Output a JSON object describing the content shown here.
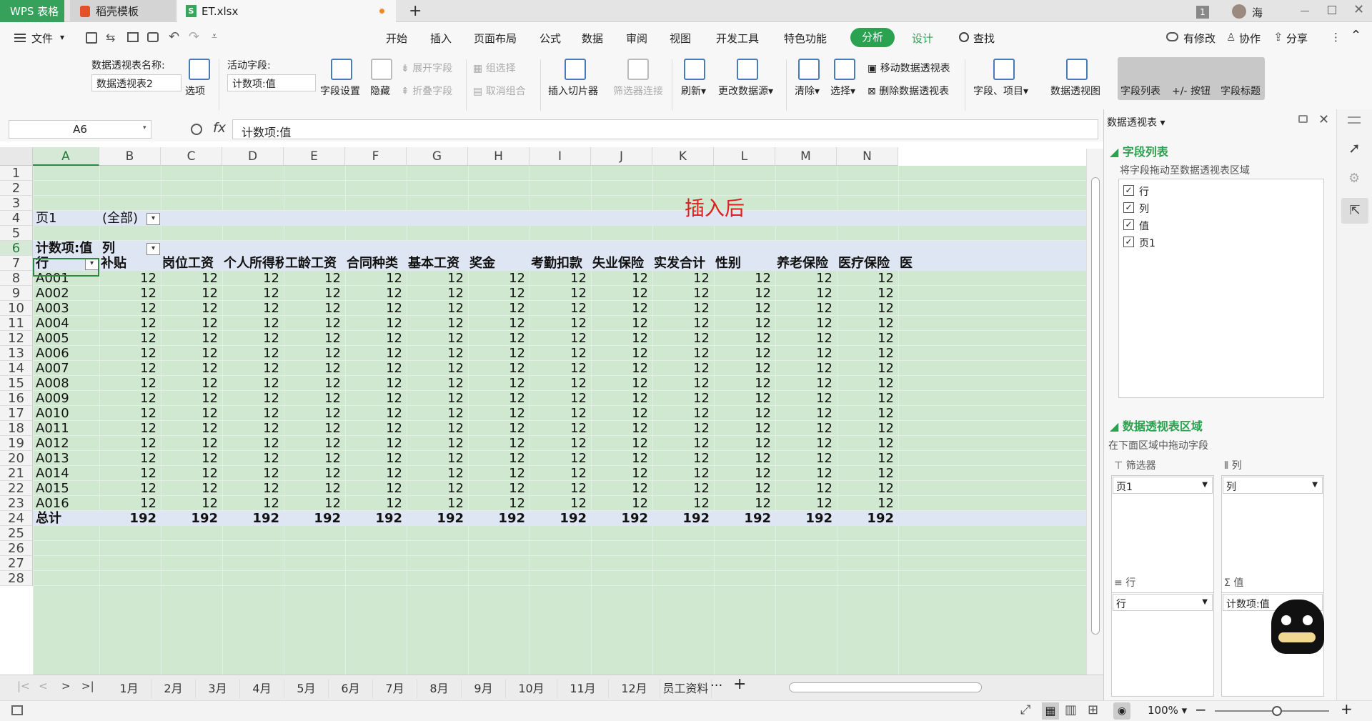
{
  "tabs": {
    "app": "WPS 表格",
    "t1": "稻壳模板",
    "t2": "ET.xlsx",
    "badge": "1",
    "user": "海"
  },
  "menu": {
    "file": "文件",
    "items": [
      "开始",
      "插入",
      "页面布局",
      "公式",
      "数据",
      "审阅",
      "视图",
      "开发工具",
      "特色功能",
      "分析",
      "设计"
    ],
    "search": "查找",
    "right": [
      "有修改",
      "协作",
      "分享"
    ]
  },
  "ribbon": {
    "pt_name_label": "数据透视表名称:",
    "pt_name": "数据透视表2",
    "options": "选项",
    "active_label": "活动字段:",
    "active_value": "计数项:值",
    "field_settings": "字段设置",
    "hide": "隐藏",
    "expand": "展开字段",
    "collapse": "折叠字段",
    "group": "组选择",
    "ungroup": "取消组合",
    "slicer": "插入切片器",
    "filter_conn": "筛选器连接",
    "refresh": "刷新",
    "change_source": "更改数据源",
    "clear": "清除",
    "select": "选择",
    "move_pt": "移动数据透视表",
    "delete_pt": "删除数据透视表",
    "fields_items": "字段、项目",
    "pt_chart": "数据透视图",
    "field_list": "字段列表",
    "buttons": "+/- 按钮",
    "headers": "字段标题"
  },
  "formula": {
    "namebox": "A6",
    "fx": "fx",
    "content": "计数项:值"
  },
  "sheet": {
    "columns": [
      "A",
      "B",
      "C",
      "D",
      "E",
      "F",
      "G",
      "H",
      "I",
      "J",
      "K",
      "L",
      "M",
      "N"
    ],
    "rows": [
      "1",
      "2",
      "3",
      "4",
      "5",
      "6",
      "7",
      "8",
      "9",
      "10",
      "11",
      "12",
      "13",
      "14",
      "15",
      "16",
      "17",
      "18",
      "19",
      "20",
      "21",
      "22",
      "23",
      "24",
      "25",
      "26",
      "27",
      "28"
    ],
    "annotation": "插入后",
    "page_label": "页1",
    "page_value": "(全部)",
    "value_label": "计数项:值",
    "col_label": "列",
    "row_label": "行",
    "col_headers": [
      "补贴",
      "岗位工资",
      "个人所得税",
      "工龄工资",
      "合同种类",
      "基本工资",
      "奖金",
      "考勤扣款",
      "失业保险",
      "实发合计",
      "性别",
      "养老保险",
      "医疗保险",
      "医"
    ],
    "row_items": [
      "A001",
      "A002",
      "A003",
      "A004",
      "A005",
      "A006",
      "A007",
      "A008",
      "A009",
      "A010",
      "A011",
      "A012",
      "A013",
      "A014",
      "A015",
      "A016"
    ],
    "cell_value": "12",
    "total_label": "总计",
    "total_value": "192"
  },
  "sheet_tabs": [
    "1月",
    "2月",
    "3月",
    "4月",
    "5月",
    "6月",
    "7月",
    "8月",
    "9月",
    "10月",
    "11月",
    "12月",
    "员工资料"
  ],
  "status": {
    "zoom": "100%"
  },
  "panel": {
    "title": "数据透视表",
    "field_list": "字段列表",
    "drag_hint": "将字段拖动至数据透视表区域",
    "fields": [
      "行",
      "列",
      "值",
      "页1"
    ],
    "areas_title": "数据透视表区域",
    "areas_hint": "在下面区域中拖动字段",
    "filter": "筛选器",
    "column": "列",
    "row": "行",
    "value": "值",
    "filter_item": "页1",
    "column_item": "列",
    "row_item": "行",
    "value_item": "计数项:值"
  }
}
